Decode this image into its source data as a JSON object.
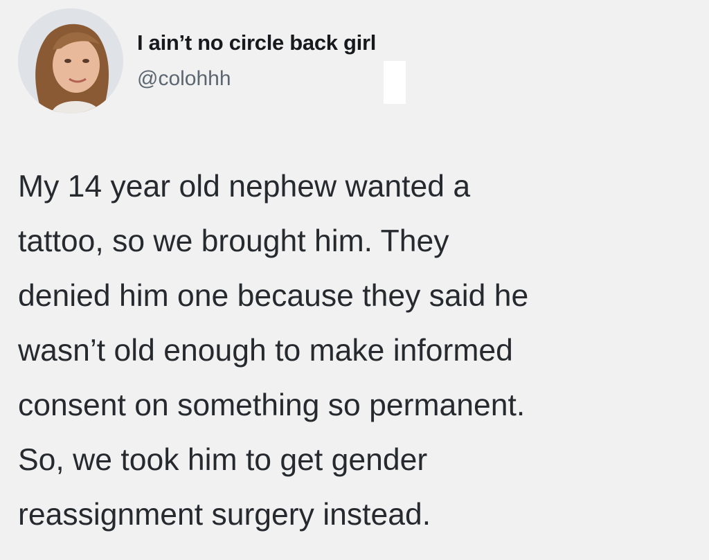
{
  "author": {
    "display_name": "I ain’t no circle back girl",
    "handle": "@colohhh",
    "avatar_icon": "profile-photo-icon"
  },
  "tweet": {
    "lines": [
      "My 14 year old nephew wanted a",
      "tattoo, so we brought him. They",
      "denied him one because they said he",
      "wasn’t old enough to make informed",
      "consent on something so permanent.",
      "So, we took him to get gender",
      "reassignment surgery instead."
    ]
  },
  "colors": {
    "background": "#f1f1f2",
    "text": "#262a2f",
    "handle": "#5c6670"
  }
}
